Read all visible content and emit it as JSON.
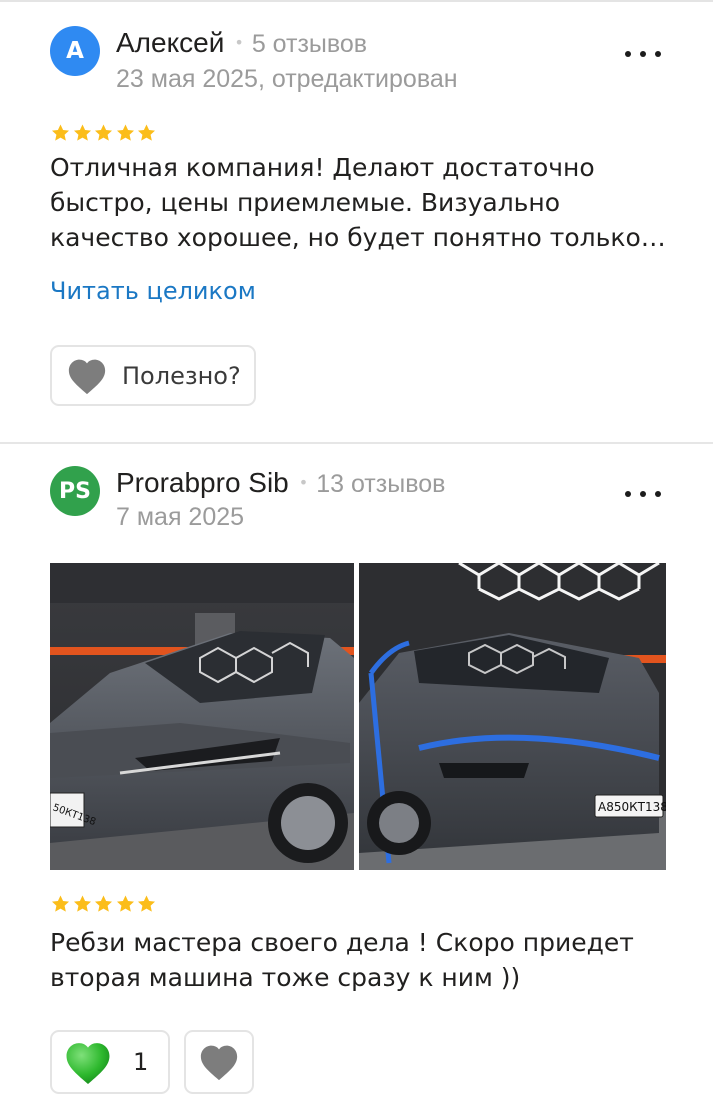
{
  "reviews": [
    {
      "avatar_letter": "А",
      "avatar_color": "#2f8af2",
      "author": "Алексей",
      "separator": "•",
      "review_count": "5 отзывов",
      "date": "23 мая 2025, отредактирован",
      "rating": 5,
      "text_lines": [
        "Отличная компания! Делают достаточно",
        "быстро, цены приемлемые. Визуально",
        "качество хорошее, но будет понятно только…"
      ],
      "read_more": "Читать целиком",
      "helpful_label": "Полезно?",
      "icons": {
        "more": "more-dots-icon",
        "helpful": "heart-outline-icon"
      }
    },
    {
      "avatar_letter": "PS",
      "avatar_color": "#31a14c",
      "author": "Prorabpro Sib",
      "separator": "•",
      "review_count": "13 отзывов",
      "date": "7 мая 2025",
      "rating": 5,
      "photos": [
        "car-photo-front-left",
        "car-photo-front-right"
      ],
      "plates": [
        "50КТ138",
        "А850КТ138"
      ],
      "text": "Ребзи мастера своего дела ! Скоро приедет вторая машина тоже сразу к ним ))",
      "like_count": "1",
      "icons": {
        "more": "more-dots-icon",
        "like": "green-heart-icon",
        "dislike": "heart-outline-icon"
      }
    }
  ],
  "colors": {
    "star": "#fbbd1a",
    "link": "#1b78c4",
    "secondary_text": "#9b9b9b",
    "like_green": "#2db82d"
  }
}
